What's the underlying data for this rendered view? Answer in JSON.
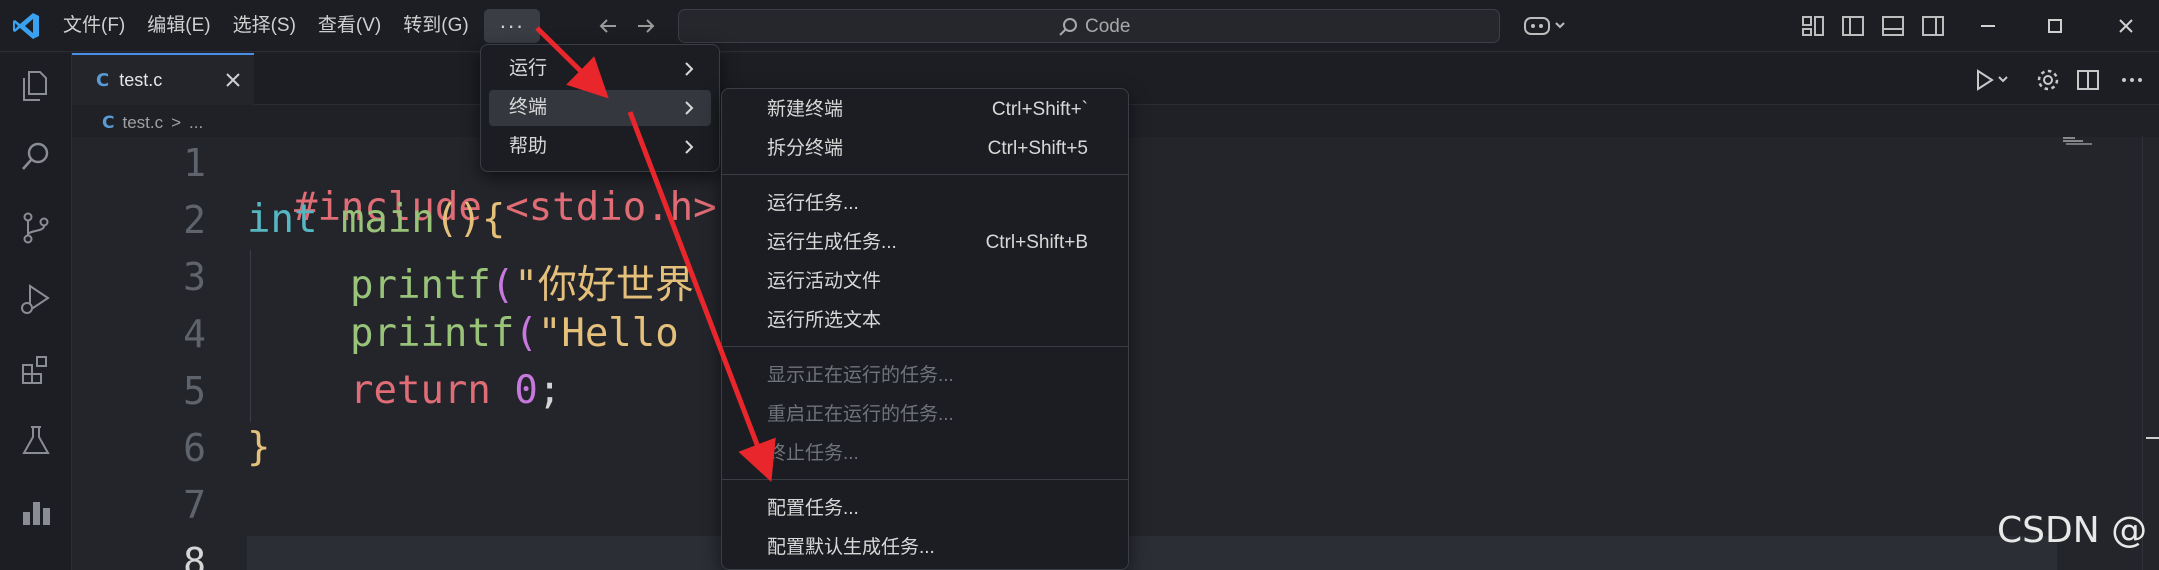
{
  "titlebar": {
    "menus": [
      "文件(F)",
      "编辑(E)",
      "选择(S)",
      "查看(V)",
      "转到(G)"
    ],
    "more_label": "···",
    "search_label": "Code"
  },
  "tab": {
    "lang": "C",
    "name": "test.c"
  },
  "breadcrumb": {
    "lang": "C",
    "file": "test.c",
    "sep": ">",
    "rest": "..."
  },
  "editor": {
    "line_numbers": [
      "1",
      "2",
      "3",
      "4",
      "5",
      "6",
      "7",
      "8"
    ],
    "current_line": "8",
    "lines": [
      {
        "t1": "#include <stdio.h>"
      },
      {
        "t1": "int",
        "t2": " ",
        "t3": "main",
        "t4": "(){"
      },
      {
        "t1": "printf",
        "t2": "(",
        "t3": "\"你好世界"
      },
      {
        "t1": "priintf",
        "t2": "(",
        "t3": "\"Hello"
      },
      {
        "t1": "return",
        "t2": " ",
        "t3": "0",
        "t4": ";"
      },
      {
        "t1": "}"
      }
    ]
  },
  "menu1": {
    "items": [
      {
        "label": "运行"
      },
      {
        "label": "终端"
      },
      {
        "label": "帮助"
      }
    ],
    "selected": "终端"
  },
  "menu2": {
    "items": [
      {
        "label": "新建终端",
        "key": "Ctrl+Shift+`"
      },
      {
        "label": "拆分终端",
        "key": "Ctrl+Shift+5"
      },
      {
        "label": "运行任务..."
      },
      {
        "label": "运行生成任务...",
        "key": "Ctrl+Shift+B"
      },
      {
        "label": "运行活动文件"
      },
      {
        "label": "运行所选文本"
      },
      {
        "label": "显示正在运行的任务...",
        "disabled": true
      },
      {
        "label": "重启正在运行的任务...",
        "disabled": true
      },
      {
        "label": "终止任务...",
        "disabled": true
      },
      {
        "label": "配置任务..."
      },
      {
        "label": "配置默认生成任务..."
      }
    ]
  },
  "watermark": "CSDN @",
  "colors": {
    "accent": "#4a8ee8",
    "arrow": "#e8262b",
    "menu_bg": "#1b1d22",
    "editor_bg": "#23252b"
  },
  "icons": [
    "vscode-logo-icon",
    "back-arrow-icon",
    "forward-arrow-icon",
    "search-icon",
    "copilot-icon",
    "layout-icon",
    "explorer-icon",
    "search-icon",
    "source-control-icon",
    "run-debug-icon",
    "extensions-icon",
    "testing-icon",
    "chart-icon",
    "run-icon",
    "settings-icon",
    "split-editor-icon"
  ]
}
